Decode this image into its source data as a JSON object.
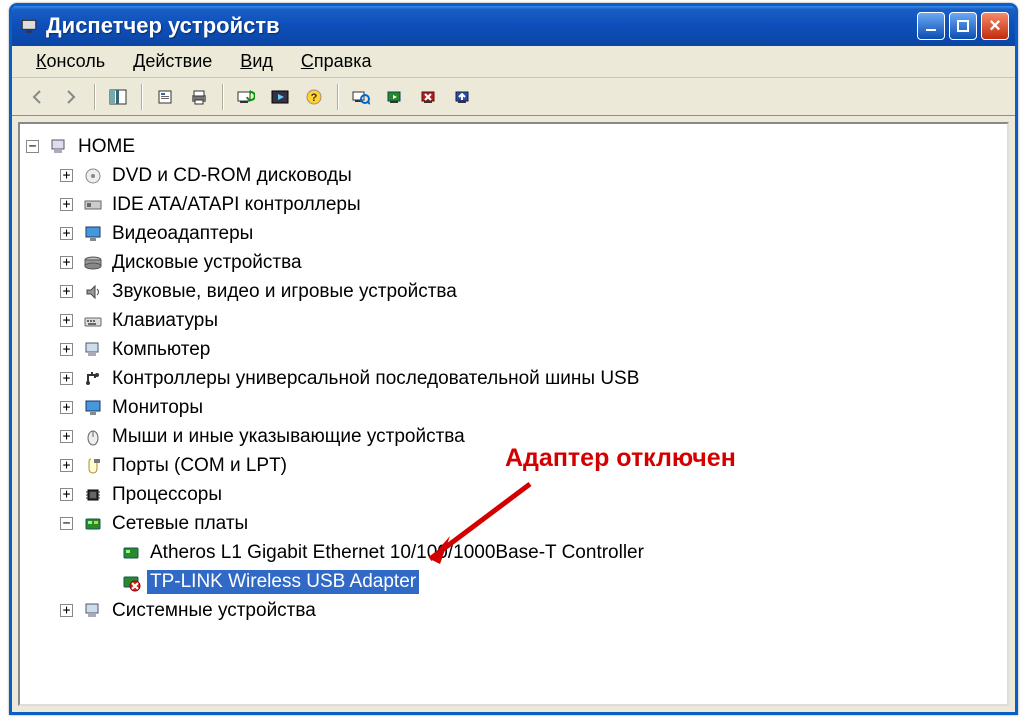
{
  "title": "Диспетчер устройств",
  "menubar": {
    "console": "Консоль",
    "action": "Действие",
    "view": "Вид",
    "help": "Справка"
  },
  "toolbar_icons": [
    "back",
    "forward",
    "up",
    "properties",
    "print",
    "refresh",
    "view",
    "help",
    "scan",
    "enable",
    "disable",
    "update"
  ],
  "tree": {
    "root": {
      "exp": "−",
      "label": "HOME"
    },
    "items": [
      {
        "exp": "+",
        "icon": "disc",
        "label": "DVD и CD-ROM дисководы"
      },
      {
        "exp": "+",
        "icon": "ide",
        "label": "IDE ATA/ATAPI контроллеры"
      },
      {
        "exp": "+",
        "icon": "display",
        "label": "Видеоадаптеры"
      },
      {
        "exp": "+",
        "icon": "disk",
        "label": "Дисковые устройства"
      },
      {
        "exp": "+",
        "icon": "sound",
        "label": "Звуковые, видео и игровые устройства"
      },
      {
        "exp": "+",
        "icon": "keyboard",
        "label": "Клавиатуры"
      },
      {
        "exp": "+",
        "icon": "computer",
        "label": "Компьютер"
      },
      {
        "exp": "+",
        "icon": "usb",
        "label": "Контроллеры универсальной последовательной шины USB"
      },
      {
        "exp": "+",
        "icon": "monitor",
        "label": "Мониторы"
      },
      {
        "exp": "+",
        "icon": "mouse",
        "label": "Мыши и иные указывающие устройства"
      },
      {
        "exp": "+",
        "icon": "port",
        "label": "Порты (COM и LPT)"
      },
      {
        "exp": "+",
        "icon": "cpu",
        "label": "Процессоры"
      },
      {
        "exp": "−",
        "icon": "network",
        "label": "Сетевые платы",
        "children": [
          {
            "icon": "network-ok",
            "label": "Atheros L1 Gigabit Ethernet 10/100/1000Base-T Controller",
            "selected": false
          },
          {
            "icon": "network-err",
            "label": "TP-LINK Wireless USB Adapter",
            "selected": true
          }
        ]
      },
      {
        "exp": "+",
        "icon": "system",
        "label": "Системные устройства"
      }
    ]
  },
  "annotation": "Адаптер отключен"
}
